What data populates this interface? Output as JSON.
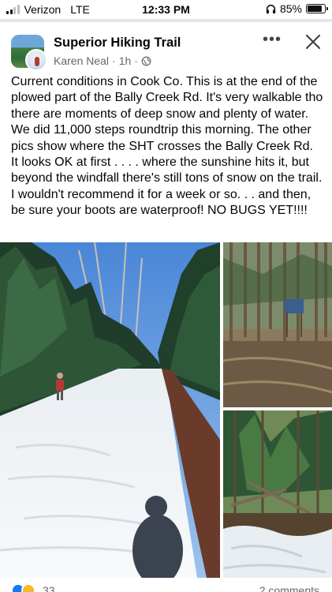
{
  "status_bar": {
    "carrier": "Verizon",
    "network": "LTE",
    "time": "12:33 PM",
    "battery_percent": "85%",
    "battery_level": 0.85,
    "icons": [
      "signal-bars-icon",
      "headphones-icon",
      "battery-icon"
    ]
  },
  "post": {
    "group_name": "Superior Hiking Trail",
    "author": "Karen Neal",
    "separator": "·",
    "time_ago": "1h",
    "separator_2": "·",
    "audience_icon": "globe-icon",
    "more_icon": "•••",
    "body": "Current conditions in Cook Co.  This is at the end of the plowed part of the Bally Creek Rd.  It's very walkable tho there are moments of deep snow and plenty of water. We did 11,000 steps roundtrip this morning.  The other pics show where the SHT crosses the Bally Creek Rd. It looks OK at first . . . . where the sunshine hits it, but beyond the windfall there's still tons of snow on the trail.  I wouldn't recommend it for a week or so. . . and then, be sure your boots are waterproof!  NO BUGS YET!!!!"
  },
  "footer": {
    "reaction_count": "33",
    "comment_count": "2 comments",
    "reaction_icons": [
      "like-reaction-icon",
      "care-reaction-icon"
    ]
  },
  "colors": {
    "text": "#050505",
    "meta": "#65676b",
    "like_blue": "#1877f2"
  }
}
